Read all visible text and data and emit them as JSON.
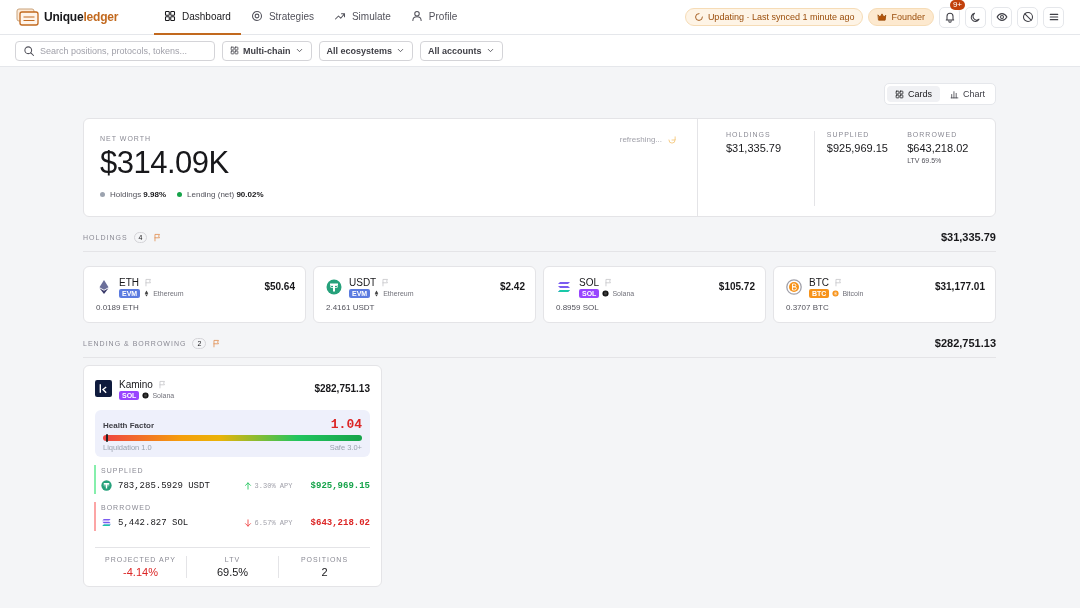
{
  "brand": {
    "name_a": "Unique",
    "name_b": "ledger"
  },
  "nav": [
    {
      "label": "Dashboard",
      "selected": true
    },
    {
      "label": "Strategies",
      "selected": false
    },
    {
      "label": "Simulate",
      "selected": false
    },
    {
      "label": "Profile",
      "selected": false
    }
  ],
  "status": "Updating · Last synced 1 minute ago",
  "role": "Founder",
  "notification_badge": "9+",
  "search": {
    "placeholder": "Search positions, protocols, tokens..."
  },
  "filters": [
    {
      "label": "Multi-chain"
    },
    {
      "label": "All ecosystems"
    },
    {
      "label": "All accounts"
    }
  ],
  "views": [
    {
      "label": "Cards",
      "selected": true
    },
    {
      "label": "Chart",
      "selected": false
    }
  ],
  "net_worth": {
    "label": "NET WORTH",
    "value": "$314.09K",
    "refresh": "refreshing...",
    "breakdown": [
      {
        "label": "Holdings",
        "value": "9.98%",
        "color": "#9ca3af"
      },
      {
        "label": "Lending (net)",
        "value": "90.02%",
        "color": "#16a34a"
      }
    ],
    "stats": [
      {
        "label": "HOLDINGS",
        "value": "$31,335.79"
      },
      {
        "label": "SUPPLIED",
        "value": "$925,969.15"
      },
      {
        "label": "BORROWED",
        "value": "$643,218.02",
        "note": "LTV 69.5%"
      }
    ]
  },
  "holdings": {
    "title": "HOLDINGS",
    "count": "4",
    "total": "$31,335.79",
    "items": [
      {
        "kind": "eth",
        "symbol": "ETH",
        "tag": "EVM",
        "color": "#5b7be0",
        "chain": "Ethereum",
        "value": "$50.64",
        "amount": "0.0189 ETH"
      },
      {
        "kind": "usdt",
        "symbol": "USDT",
        "tag": "EVM",
        "color": "#5b7be0",
        "chain": "Ethereum",
        "value": "$2.42",
        "amount": "2.4161 USDT"
      },
      {
        "kind": "sol",
        "symbol": "SOL",
        "tag": "SOL",
        "color": "#9945ff",
        "chain": "Solana",
        "value": "$105.72",
        "amount": "0.8959 SOL"
      },
      {
        "kind": "btc",
        "symbol": "BTC",
        "tag": "BTC",
        "color": "#f7931a",
        "chain": "Bitcoin",
        "value": "$31,177.01",
        "amount": "0.3707 BTC"
      }
    ]
  },
  "lending": {
    "title": "LENDING & BORROWING",
    "count": "2",
    "total": "$282,751.13",
    "cards": [
      {
        "protocol": "Kamino",
        "tag": "SOL",
        "chain": "Solana",
        "value": "$282,751.13",
        "health": {
          "label": "Health Factor",
          "value": "1.04",
          "level": 0.01,
          "min_label": "Liquidation 1.0",
          "max_label": "Safe 3.0+"
        },
        "sections": [
          {
            "kind": "supplied",
            "title": "SUPPLIED",
            "amount": "783,285.5929 USDT",
            "apy": "3.30% APY",
            "value": "$925,969.15"
          },
          {
            "kind": "borrowed",
            "title": "BORROWED",
            "amount": "5,442.827 SOL",
            "apy": "6.57% APY",
            "value": "$643,218.02"
          }
        ],
        "footer": [
          {
            "label": "PROJECTED APY",
            "value": "-4.14%",
            "negative": true
          },
          {
            "label": "LTV",
            "value": "69.5%",
            "negative": false
          },
          {
            "label": "POSITIONS",
            "value": "2",
            "negative": false
          }
        ]
      }
    ]
  }
}
